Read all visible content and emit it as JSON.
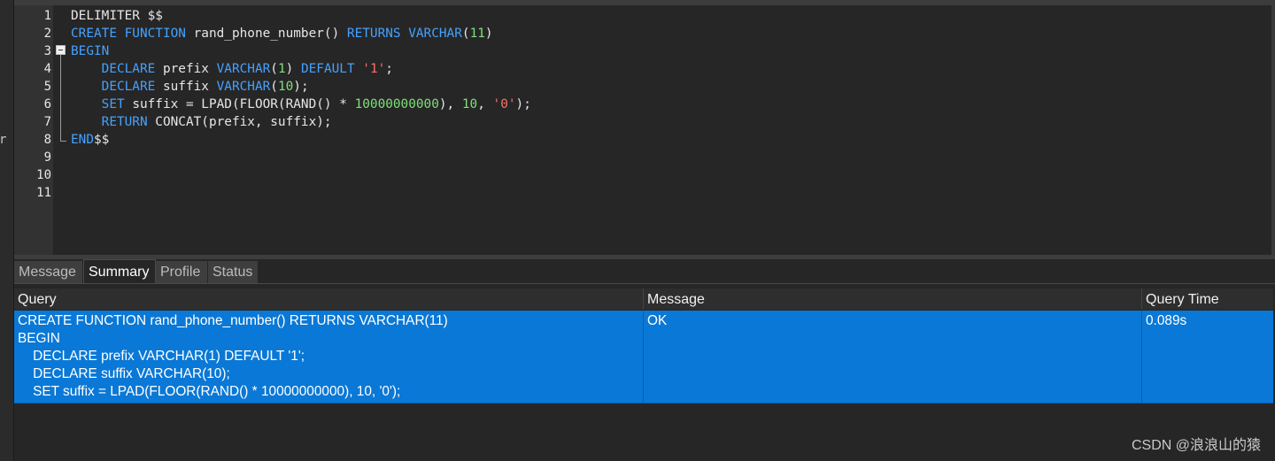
{
  "editor": {
    "line_numbers": [
      "1",
      "2",
      "3",
      "4",
      "5",
      "6",
      "7",
      "8",
      "9",
      "10",
      "11"
    ],
    "code_lines": [
      [
        {
          "t": "DELIMITER $$",
          "c": ""
        }
      ],
      [
        {
          "t": "CREATE FUNCTION",
          "c": "kw"
        },
        {
          "t": " rand_phone_number() ",
          "c": ""
        },
        {
          "t": "RETURNS VARCHAR",
          "c": "kw"
        },
        {
          "t": "(",
          "c": ""
        },
        {
          "t": "11",
          "c": "num"
        },
        {
          "t": ")",
          "c": ""
        }
      ],
      [
        {
          "t": "BEGIN",
          "c": "kw"
        }
      ],
      [
        {
          "t": "    ",
          "c": ""
        },
        {
          "t": "DECLARE",
          "c": "kw"
        },
        {
          "t": " prefix ",
          "c": ""
        },
        {
          "t": "VARCHAR",
          "c": "kw"
        },
        {
          "t": "(",
          "c": ""
        },
        {
          "t": "1",
          "c": "num"
        },
        {
          "t": ") ",
          "c": ""
        },
        {
          "t": "DEFAULT",
          "c": "kw"
        },
        {
          "t": " ",
          "c": ""
        },
        {
          "t": "'1'",
          "c": "str"
        },
        {
          "t": ";",
          "c": ""
        }
      ],
      [
        {
          "t": "    ",
          "c": ""
        },
        {
          "t": "DECLARE",
          "c": "kw"
        },
        {
          "t": " suffix ",
          "c": ""
        },
        {
          "t": "VARCHAR",
          "c": "kw"
        },
        {
          "t": "(",
          "c": ""
        },
        {
          "t": "10",
          "c": "num"
        },
        {
          "t": ");",
          "c": ""
        }
      ],
      [
        {
          "t": "    ",
          "c": ""
        },
        {
          "t": "SET",
          "c": "kw"
        },
        {
          "t": " suffix = LPAD(FLOOR(RAND() * ",
          "c": ""
        },
        {
          "t": "10000000000",
          "c": "num"
        },
        {
          "t": "), ",
          "c": ""
        },
        {
          "t": "10",
          "c": "num"
        },
        {
          "t": ", ",
          "c": ""
        },
        {
          "t": "'0'",
          "c": "str"
        },
        {
          "t": ");",
          "c": ""
        }
      ],
      [
        {
          "t": "    ",
          "c": ""
        },
        {
          "t": "RETURN",
          "c": "kw"
        },
        {
          "t": " CONCAT(prefix, suffix);",
          "c": ""
        }
      ],
      [
        {
          "t": "END",
          "c": "kw"
        },
        {
          "t": "$$",
          "c": ""
        }
      ],
      [
        {
          "t": "",
          "c": ""
        }
      ],
      [
        {
          "t": "",
          "c": ""
        }
      ],
      [
        {
          "t": "",
          "c": ""
        }
      ]
    ]
  },
  "left_edge_char": "r",
  "result_tabs": [
    "Message",
    "Summary",
    "Profile",
    "Status"
  ],
  "active_tab": "Summary",
  "grid": {
    "columns": [
      "Query",
      "Message",
      "Query Time"
    ],
    "rows": [
      {
        "query": "CREATE FUNCTION rand_phone_number() RETURNS VARCHAR(11)\nBEGIN\n    DECLARE prefix VARCHAR(1) DEFAULT '1';\n    DECLARE suffix VARCHAR(10);\n    SET suffix = LPAD(FLOOR(RAND() * 10000000000), 10, '0');",
        "message": "OK",
        "query_time": "0.089s"
      }
    ]
  },
  "watermark": "CSDN @浪浪山的猿",
  "colors": {
    "keyword": "#45a1ff",
    "number": "#7fe07a",
    "string": "#ff6e6e",
    "selection": "#0a78d6"
  }
}
